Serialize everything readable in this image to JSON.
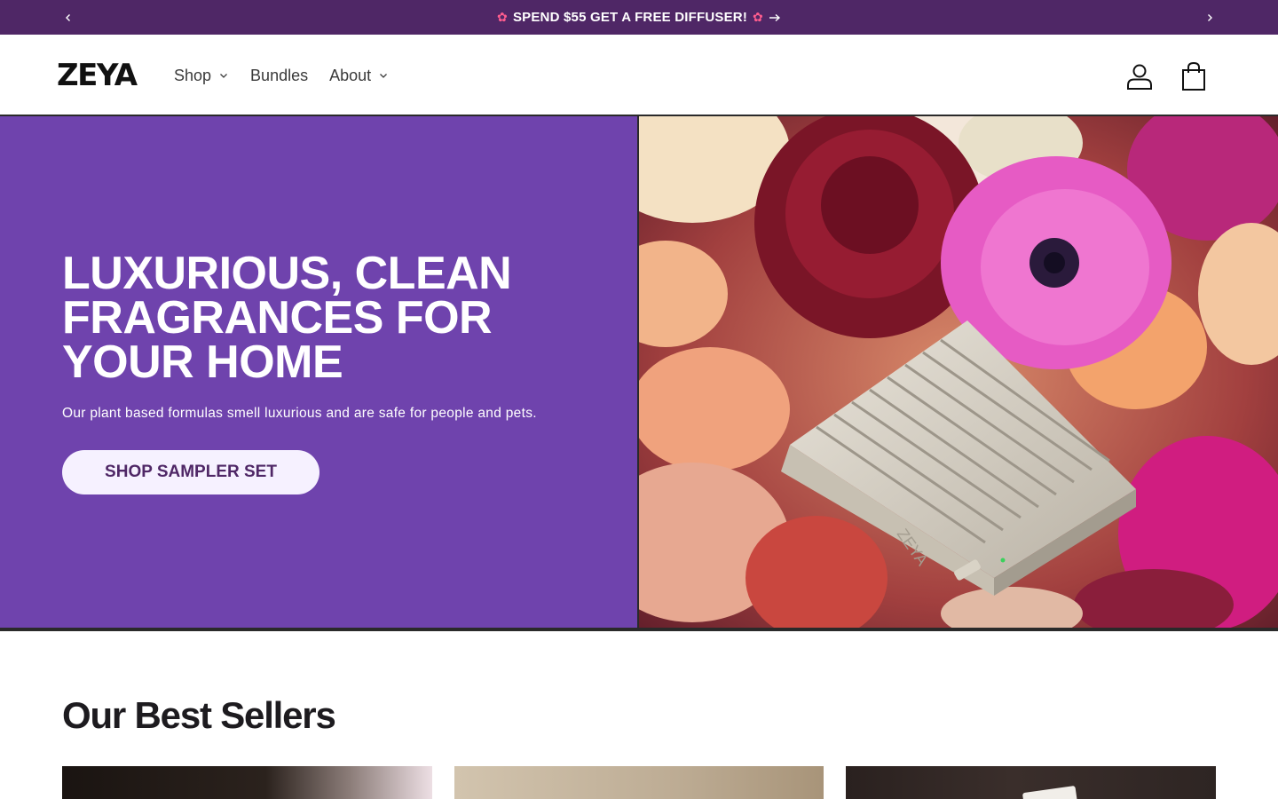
{
  "announcement": {
    "message": "SPEND $55 GET A FREE DIFFUSER!",
    "prev_icon": "chevron-left-icon",
    "next_icon": "chevron-right-icon",
    "flower_icon": "flower-emoji-icon",
    "arrow_icon": "arrow-right-icon",
    "background": "#4f2766"
  },
  "header": {
    "logo": "ZEYA",
    "nav": [
      {
        "label": "Shop",
        "has_dropdown": true
      },
      {
        "label": "Bundles",
        "has_dropdown": false
      },
      {
        "label": "About",
        "has_dropdown": true
      }
    ],
    "account_icon": "user-icon",
    "cart_icon": "shopping-bag-icon"
  },
  "hero": {
    "title": "LUXURIOUS, CLEAN FRAGRANCES FOR YOUR HOME",
    "subtitle": "Our plant based formulas smell luxurious and are safe for people and pets.",
    "cta_label": "SHOP SAMPLER SET",
    "background": "#6f43ad",
    "image": "diffuser-with-flowers-photo",
    "image_brand_text": "ZEYA"
  },
  "best_sellers": {
    "title": "Our Best Sellers",
    "cards": [
      {
        "image": "product-photo-1"
      },
      {
        "image": "product-photo-2"
      },
      {
        "image": "product-photo-3"
      }
    ]
  }
}
